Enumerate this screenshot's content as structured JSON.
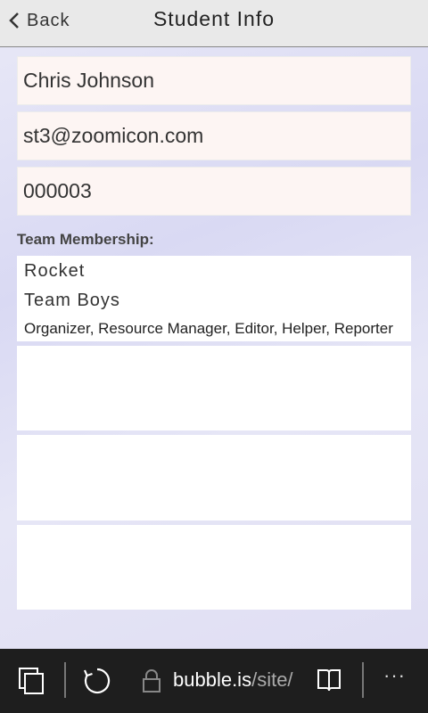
{
  "header": {
    "back_label": "Back",
    "title": "Student Info"
  },
  "fields": {
    "name": "Chris Johnson",
    "email": "st3@zoomicon.com",
    "id": "000003"
  },
  "membership": {
    "label": "Team Membership:",
    "teams": [
      {
        "team": "Rocket"
      },
      {
        "team": "Team Boys",
        "roles": "Organizer, Resource Manager, Editor, Helper, Reporter"
      }
    ]
  },
  "browser": {
    "url_host": "bubble.is",
    "url_path": "/site/",
    "more": "···"
  }
}
